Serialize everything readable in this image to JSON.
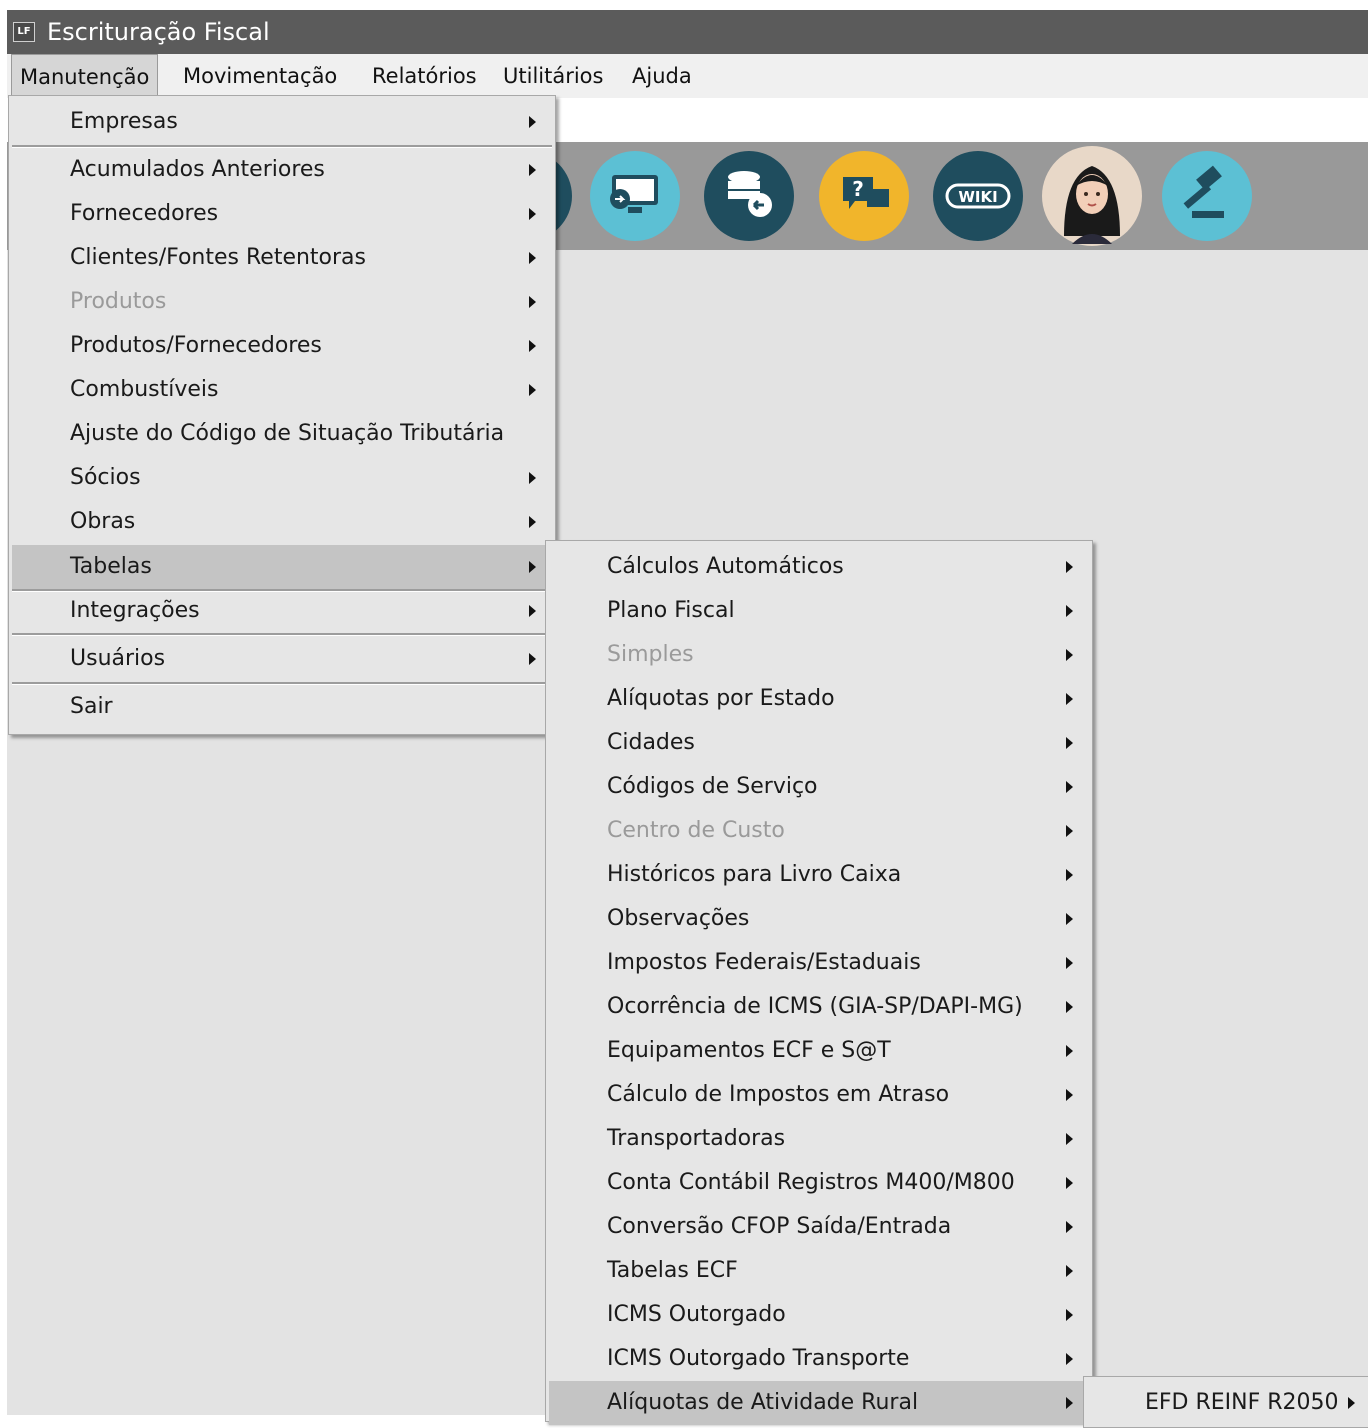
{
  "app": {
    "logo_text": "LF",
    "title": "Escrituração Fiscal"
  },
  "menubar": [
    {
      "label": "Manutenção"
    },
    {
      "label": "Movimentação"
    },
    {
      "label": "Relatórios"
    },
    {
      "label": "Utilitários"
    },
    {
      "label": "Ajuda"
    }
  ],
  "toolbar": {
    "icons": [
      "computer-transfer-icon",
      "database-sync-icon",
      "help-chat-icon",
      "wiki-icon",
      "assistant-avatar-icon",
      "gavel-icon"
    ],
    "wiki_text": "WIKI",
    "help_text": "?"
  },
  "manutencao_menu": {
    "items": [
      {
        "label": "Empresas"
      },
      {
        "label": "Acumulados Anteriores"
      },
      {
        "label": "Fornecedores"
      },
      {
        "label": "Clientes/Fontes Retentoras"
      },
      {
        "label": "Produtos"
      },
      {
        "label": "Produtos/Fornecedores"
      },
      {
        "label": "Combustíveis"
      },
      {
        "label": "Ajuste do Código de Situação Tributária"
      },
      {
        "label": "Sócios"
      },
      {
        "label": "Obras"
      },
      {
        "label": "Tabelas"
      },
      {
        "label": "Integrações"
      },
      {
        "label": "Usuários"
      },
      {
        "label": "Sair"
      }
    ]
  },
  "tabelas_menu": {
    "items": [
      {
        "label": "Cálculos Automáticos"
      },
      {
        "label": "Plano Fiscal"
      },
      {
        "label": "Simples"
      },
      {
        "label": "Alíquotas por Estado"
      },
      {
        "label": "Cidades"
      },
      {
        "label": "Códigos de Serviço"
      },
      {
        "label": "Centro de Custo"
      },
      {
        "label": "Históricos para Livro Caixa"
      },
      {
        "label": "Observações"
      },
      {
        "label": "Impostos Federais/Estaduais"
      },
      {
        "label": "Ocorrência de ICMS (GIA-SP/DAPI-MG)"
      },
      {
        "label": "Equipamentos ECF e S@T"
      },
      {
        "label": "Cálculo de Impostos em Atraso"
      },
      {
        "label": "Transportadoras"
      },
      {
        "label": "Conta Contábil Registros M400/M800"
      },
      {
        "label": "Conversão CFOP Saída/Entrada"
      },
      {
        "label": "Tabelas ECF"
      },
      {
        "label": "ICMS Outorgado"
      },
      {
        "label": "ICMS Outorgado Transporte"
      },
      {
        "label": "Alíquotas de Atividade Rural"
      }
    ]
  },
  "rural_menu": {
    "items": [
      {
        "label": "EFD REINF R2050"
      }
    ]
  }
}
